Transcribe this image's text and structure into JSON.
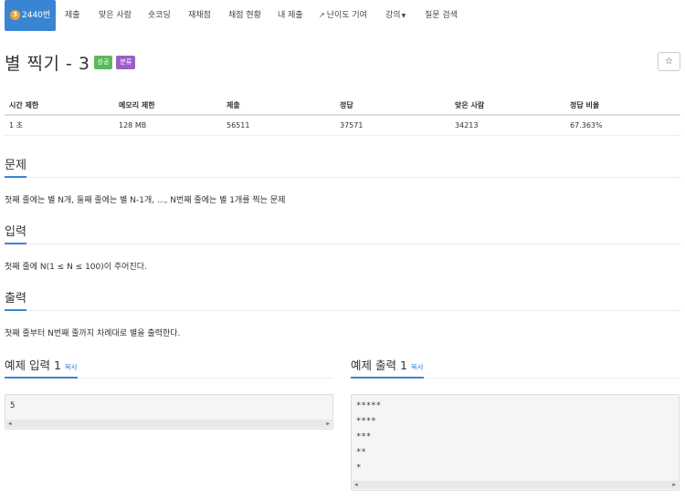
{
  "nav": {
    "problem_number": "2440번",
    "badge_level": "3",
    "tabs": [
      "제출",
      "맞은 사람",
      "숏코딩",
      "재채점",
      "채점 현황",
      "내 제출",
      "난이도 기여",
      "강의",
      "질문 검색"
    ]
  },
  "problem": {
    "title": "별 찍기 - 3",
    "label_success": "성공",
    "label_category": "분류",
    "star_icon": "☆"
  },
  "info": {
    "headers": [
      "시간 제한",
      "메모리 제한",
      "제출",
      "정답",
      "맞은 사람",
      "정답 비율"
    ],
    "values": [
      "1 초",
      "128 MB",
      "56511",
      "37571",
      "34213",
      "67.363%"
    ]
  },
  "sections": {
    "problem_heading": "문제",
    "problem_text": "첫째 줄에는 별 N개, 둘째 줄에는 별 N-1개, ..., N번째 줄에는 별 1개를 찍는 문제",
    "input_heading": "입력",
    "input_text": "첫째 줄에 N(1 ≤ N ≤ 100)이 주어진다.",
    "output_heading": "출력",
    "output_text": "첫째 줄부터 N번째 줄까지 차례대로 별을 출력한다."
  },
  "samples": {
    "input_heading": "예제 입력 1",
    "output_heading": "예제 출력 1",
    "copy_label": "복사",
    "input_lines": [
      "5"
    ],
    "output_lines": [
      "*****",
      "****",
      "***",
      "**",
      "*"
    ]
  },
  "colors": {
    "accent": "#3a85d3",
    "success": "#5cb85c",
    "category": "#9c5fc8"
  }
}
